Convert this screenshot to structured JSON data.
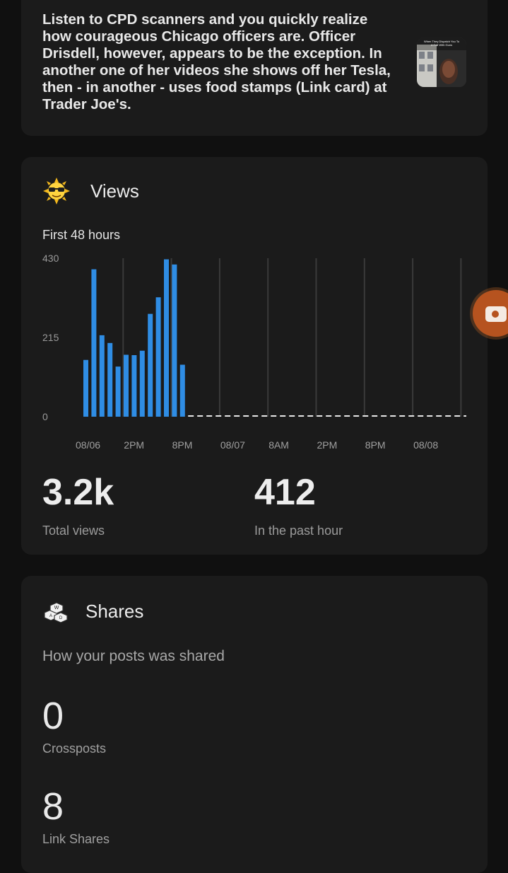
{
  "post": {
    "text": "Listen to CPD scanners and you quickly realize how courageous Chicago officers are. Officer Drisdell, however, appears to be the exception. In another one of her videos she shows off her Tesla, then - in another - uses food stamps (Link card) at Trader Joe's.",
    "thumbnail_caption": "When They Dispatch You To A Call With Guns"
  },
  "views": {
    "title": "Views",
    "subtitle": "First 48 hours",
    "total_value": "3.2k",
    "total_label": "Total views",
    "hour_value": "412",
    "hour_label": "In the past hour"
  },
  "chart_data": {
    "type": "bar",
    "title": "First 48 hours",
    "ylim": [
      0,
      430
    ],
    "y_ticks": [
      "0",
      "215",
      "430"
    ],
    "x_tick_labels": [
      "08/06",
      "2PM",
      "8PM",
      "08/07",
      "8AM",
      "2PM",
      "8PM",
      "08/08"
    ],
    "values": [
      154,
      400,
      221,
      200,
      136,
      168,
      167,
      179,
      279,
      324,
      427,
      413,
      141
    ],
    "bar_color": "#2f8de4",
    "grid": "vertical",
    "remaining_hours": "dashed baseline"
  },
  "shares": {
    "title": "Shares",
    "description": "How your posts was shared",
    "crossposts_value": "0",
    "crossposts_label": "Crossposts",
    "link_value": "8",
    "link_label": "Link Shares"
  },
  "icons": {
    "views": "sunglasses-sun-icon",
    "shares": "keycaps-icon",
    "fab": "camera-icon"
  },
  "colors": {
    "background": "#101010",
    "card": "#1b1b1b",
    "bar": "#2f8de4",
    "fab": "#b6531f"
  }
}
